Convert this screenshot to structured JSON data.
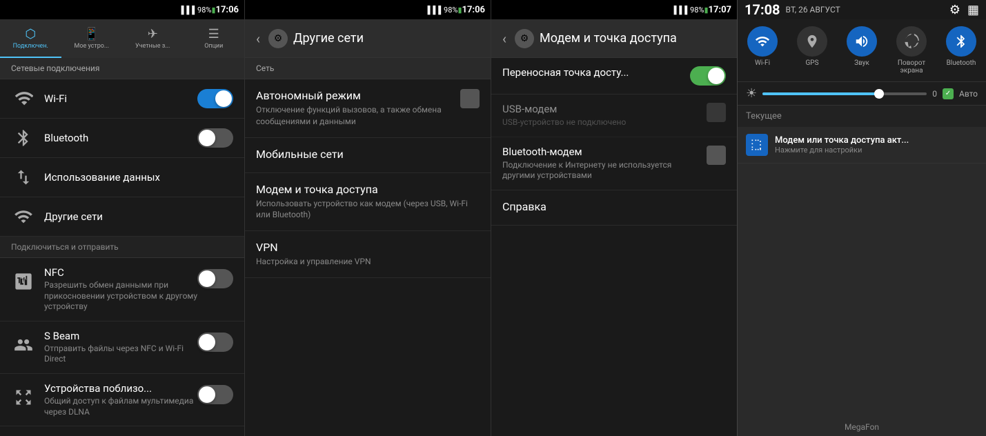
{
  "panel1": {
    "status_bar": {
      "signal": "▌▌▌▌",
      "battery": "98%",
      "time": "17:06"
    },
    "tabs": [
      {
        "icon": "📶",
        "label": "Подключен."
      },
      {
        "icon": "📱",
        "label": "Мое устро..."
      },
      {
        "icon": "✈",
        "label": "Учетные з..."
      },
      {
        "icon": "☰",
        "label": "Опции"
      }
    ],
    "section_network": "Сетевые подключения",
    "items": [
      {
        "icon": "wifi",
        "title": "Wi-Fi",
        "toggle": true,
        "toggle_on": true
      },
      {
        "icon": "bluetooth",
        "title": "Bluetooth",
        "toggle": true,
        "toggle_on": false
      }
    ],
    "items2": [
      {
        "icon": "data",
        "title": "Использование данных"
      },
      {
        "icon": "network",
        "title": "Другие сети"
      }
    ],
    "section_connect": "Подключиться и отправить",
    "nfc": {
      "title": "NFC",
      "subtitle": "Разрешить обмен данными при прикосновении устройством к другому устройству",
      "toggle": false
    },
    "sbeam": {
      "title": "S Beam",
      "subtitle": "Отправить файлы через NFC и Wi-Fi Direct",
      "toggle": false
    },
    "nearby": {
      "title": "Устройства поблизо...",
      "subtitle": "Общий доступ к файлам мультимедиа через DLNA",
      "toggle": false
    }
  },
  "panel2": {
    "status_bar": {
      "signal": "▌▌▌▌",
      "battery": "98%",
      "time": "17:06"
    },
    "header_title": "Другие сети",
    "section_label": "Сеть",
    "items": [
      {
        "title": "Автономный режим",
        "subtitle": "Отключение функций вызовов, а также обмена сообщениями и данными",
        "has_checkbox": true
      },
      {
        "title": "Мобильные сети",
        "subtitle": ""
      },
      {
        "title": "Модем и точка доступа",
        "subtitle": "Использовать устройство как модем (через USB, Wi-Fi или Bluetooth)"
      },
      {
        "title": "VPN",
        "subtitle": "Настройка и управление VPN"
      }
    ]
  },
  "panel3": {
    "status_bar": {
      "signal": "▌▌▌▌",
      "battery": "98%",
      "time": "17:07"
    },
    "header_title": "Модем и точка доступа",
    "items": [
      {
        "title": "Переносная точка досту...",
        "subtitle": "",
        "toggle": true,
        "toggle_on": true
      },
      {
        "title": "USB-модем",
        "subtitle": "USB-устройство не подключено",
        "checkbox": true,
        "disabled": true
      },
      {
        "title": "Bluetooth-модем",
        "subtitle": "Подключение к Интернету не используется другими устройствами",
        "checkbox": true
      },
      {
        "title": "Справка",
        "subtitle": ""
      }
    ]
  },
  "panel4": {
    "time": "17:08",
    "date": "ВТ, 26 АВГУСТ",
    "icons_right": [
      "⚙",
      "▦"
    ],
    "toggles": [
      {
        "icon": "📶",
        "label": "Wi-Fi",
        "active": true
      },
      {
        "icon": "◎",
        "label": "GPS",
        "active": false
      },
      {
        "icon": "🔊",
        "label": "Звук",
        "active": true
      },
      {
        "icon": "↺",
        "label": "Поворот экрана",
        "active": false
      },
      {
        "icon": "❋",
        "label": "Bluetooth",
        "active": true
      }
    ],
    "brightness_value": "0",
    "auto_label": "Авто",
    "current_label": "Текущее",
    "notification": {
      "title": "Модем или точка доступа акт...",
      "subtitle": "Нажмите для настройки"
    },
    "carrier": "MegaFon"
  }
}
